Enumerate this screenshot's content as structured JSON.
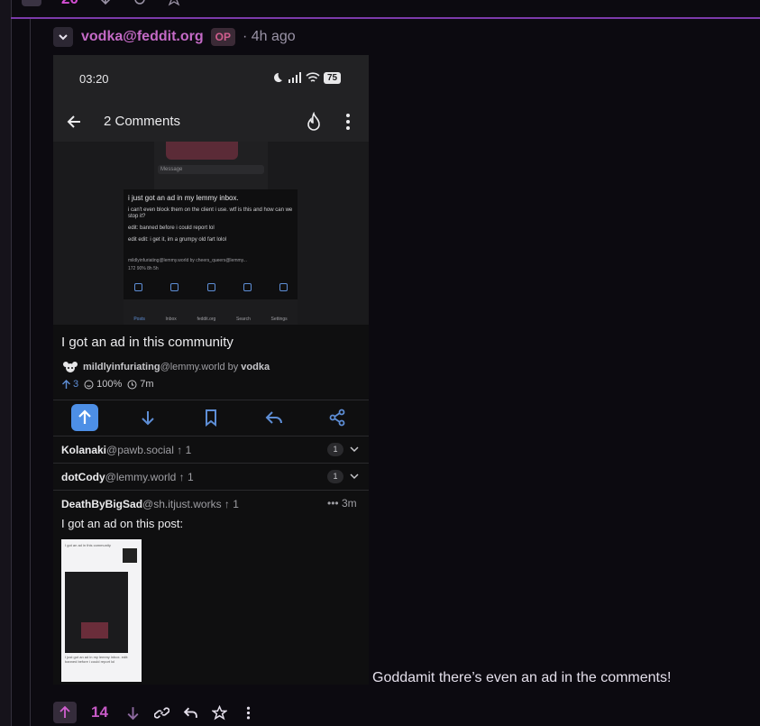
{
  "parent_actions": {
    "score": "20"
  },
  "comment": {
    "author": "vodka@feddit.org",
    "op_badge": "OP",
    "time": "· 4h ago",
    "text": "Goddamit there’s even an ad in the comments!",
    "score": "14"
  },
  "screenshot": {
    "status_time": "03:20",
    "battery": "75",
    "app_title": "2 Comments",
    "inner": {
      "message_placeholder": "Message",
      "title": "i just got an ad in my lemmy inbox.",
      "body": [
        "i can't even block them on the client i use. wtf is this and how can we stop it?",
        "edit: banned before i could report lol",
        "edit edit: i get it, im a grumpy old fart lolol"
      ],
      "meta": "mildlyinfuriating@lemmy.world by cheers_queers@lemmy...",
      "stats": "172  90%  8h  5h",
      "nav": [
        "Posts",
        "Inbox",
        "feddit.org",
        "Search",
        "Settings"
      ]
    },
    "post": {
      "title": "I got an ad in this community",
      "community_name": "mildlyinfuriating",
      "community_instance": "@lemmy.world",
      "by_label": "by",
      "author": "vodka",
      "votes": "3",
      "ratio": "100%",
      "age": "7m"
    },
    "replies": [
      {
        "user": "Kolanaki",
        "instance": "@pawb.social",
        "votes": "1",
        "count": "1"
      },
      {
        "user": "dotCody",
        "instance": "@lemmy.world",
        "votes": "1",
        "count": "1"
      }
    ],
    "open_reply": {
      "user": "DeathByBigSad",
      "instance": "@sh.itjust.works",
      "votes": "1",
      "time": "••• 3m",
      "text": "I got an ad on this post:",
      "thumb_text": "I got an ad in this community",
      "thumb_footer": "I just got an ad in my lemmy inbox. edit: banned before i could report lol"
    }
  },
  "colors": {
    "accent": "#c75ac6",
    "divider": "#7c3aaa",
    "upvote_active": "#4d8fe6"
  }
}
